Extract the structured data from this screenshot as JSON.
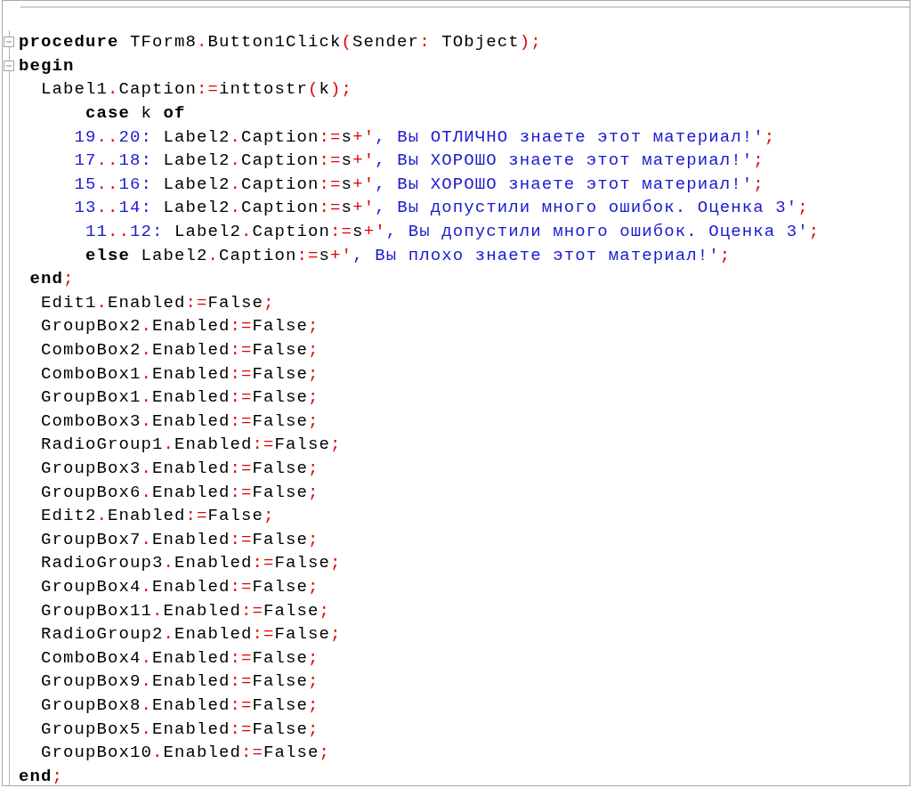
{
  "editor": {
    "lines": [
      {
        "expanded": true,
        "tokens": [
          {
            "text": "procedure",
            "kind": "keyword"
          },
          {
            "text": " TForm8",
            "kind": "ident"
          },
          {
            "text": ".",
            "kind": "symbol"
          },
          {
            "text": "Button1Click",
            "kind": "ident"
          },
          {
            "text": "(",
            "kind": "symbol"
          },
          {
            "text": "Sender",
            "kind": "ident"
          },
          {
            "text": ":",
            "kind": "symbol"
          },
          {
            "text": " TObject",
            "kind": "ident"
          },
          {
            "text": ");",
            "kind": "symbol"
          }
        ]
      },
      {
        "expanded": true,
        "tokens": [
          {
            "text": "begin",
            "kind": "keyword"
          }
        ]
      },
      {
        "tokens": [
          {
            "text": "  Label1",
            "kind": "ident"
          },
          {
            "text": ".",
            "kind": "symbol"
          },
          {
            "text": "Caption",
            "kind": "ident"
          },
          {
            "text": ":=",
            "kind": "symbol"
          },
          {
            "text": "inttostr",
            "kind": "ident"
          },
          {
            "text": "(",
            "kind": "symbol"
          },
          {
            "text": "k",
            "kind": "ident"
          },
          {
            "text": ");",
            "kind": "symbol"
          }
        ]
      },
      {
        "tokens": [
          {
            "text": "      case",
            "kind": "keyword"
          },
          {
            "text": " k ",
            "kind": "ident"
          },
          {
            "text": "of",
            "kind": "keyword"
          }
        ]
      },
      {
        "tokens": [
          {
            "text": "     19",
            "kind": "number"
          },
          {
            "text": "..",
            "kind": "symbol"
          },
          {
            "text": "20:",
            "kind": "number"
          },
          {
            "text": " Label2",
            "kind": "ident"
          },
          {
            "text": ".",
            "kind": "symbol"
          },
          {
            "text": "Caption",
            "kind": "ident"
          },
          {
            "text": ":=",
            "kind": "symbol"
          },
          {
            "text": "s",
            "kind": "ident"
          },
          {
            "text": "+'",
            "kind": "symbol"
          },
          {
            "text": ", Вы ОТЛИЧНО знаете этот материал!'",
            "kind": "string"
          },
          {
            "text": ";",
            "kind": "symbol"
          }
        ]
      },
      {
        "tokens": [
          {
            "text": "     17",
            "kind": "number"
          },
          {
            "text": "..",
            "kind": "symbol"
          },
          {
            "text": "18:",
            "kind": "number"
          },
          {
            "text": " Label2",
            "kind": "ident"
          },
          {
            "text": ".",
            "kind": "symbol"
          },
          {
            "text": "Caption",
            "kind": "ident"
          },
          {
            "text": ":=",
            "kind": "symbol"
          },
          {
            "text": "s",
            "kind": "ident"
          },
          {
            "text": "+'",
            "kind": "symbol"
          },
          {
            "text": ", Вы ХОРОШО знаете этот материал!'",
            "kind": "string"
          },
          {
            "text": ";",
            "kind": "symbol"
          }
        ]
      },
      {
        "tokens": [
          {
            "text": "     15",
            "kind": "number"
          },
          {
            "text": "..",
            "kind": "symbol"
          },
          {
            "text": "16:",
            "kind": "number"
          },
          {
            "text": " Label2",
            "kind": "ident"
          },
          {
            "text": ".",
            "kind": "symbol"
          },
          {
            "text": "Caption",
            "kind": "ident"
          },
          {
            "text": ":=",
            "kind": "symbol"
          },
          {
            "text": "s",
            "kind": "ident"
          },
          {
            "text": "+'",
            "kind": "symbol"
          },
          {
            "text": ", Вы ХОРОШО знаете этот материал!'",
            "kind": "string"
          },
          {
            "text": ";",
            "kind": "symbol"
          }
        ]
      },
      {
        "tokens": [
          {
            "text": "     13",
            "kind": "number"
          },
          {
            "text": "..",
            "kind": "symbol"
          },
          {
            "text": "14:",
            "kind": "number"
          },
          {
            "text": " Label2",
            "kind": "ident"
          },
          {
            "text": ".",
            "kind": "symbol"
          },
          {
            "text": "Caption",
            "kind": "ident"
          },
          {
            "text": ":=",
            "kind": "symbol"
          },
          {
            "text": "s",
            "kind": "ident"
          },
          {
            "text": "+'",
            "kind": "symbol"
          },
          {
            "text": ", Вы допустили много ошибок. Оценка 3'",
            "kind": "string"
          },
          {
            "text": ";",
            "kind": "symbol"
          }
        ]
      },
      {
        "tokens": [
          {
            "text": "      11",
            "kind": "number"
          },
          {
            "text": "..",
            "kind": "symbol"
          },
          {
            "text": "12:",
            "kind": "number"
          },
          {
            "text": " Label2",
            "kind": "ident"
          },
          {
            "text": ".",
            "kind": "symbol"
          },
          {
            "text": "Caption",
            "kind": "ident"
          },
          {
            "text": ":=",
            "kind": "symbol"
          },
          {
            "text": "s",
            "kind": "ident"
          },
          {
            "text": "+'",
            "kind": "symbol"
          },
          {
            "text": ", Вы допустили много ошибок. Оценка 3'",
            "kind": "string"
          },
          {
            "text": ";",
            "kind": "symbol"
          }
        ]
      },
      {
        "tokens": [
          {
            "text": "      else",
            "kind": "keyword"
          },
          {
            "text": " Label2",
            "kind": "ident"
          },
          {
            "text": ".",
            "kind": "symbol"
          },
          {
            "text": "Caption",
            "kind": "ident"
          },
          {
            "text": ":=",
            "kind": "symbol"
          },
          {
            "text": "s",
            "kind": "ident"
          },
          {
            "text": "+'",
            "kind": "symbol"
          },
          {
            "text": ", Вы плохо знаете этот материал!'",
            "kind": "string"
          },
          {
            "text": ";",
            "kind": "symbol"
          }
        ]
      },
      {
        "tokens": [
          {
            "text": " end",
            "kind": "keyword"
          },
          {
            "text": ";",
            "kind": "symbol"
          }
        ]
      },
      {
        "tokens": [
          {
            "text": "  Edit1",
            "kind": "ident"
          },
          {
            "text": ".",
            "kind": "symbol"
          },
          {
            "text": "Enabled",
            "kind": "ident"
          },
          {
            "text": ":=",
            "kind": "symbol"
          },
          {
            "text": "False",
            "kind": "ident"
          },
          {
            "text": ";",
            "kind": "symbol"
          }
        ]
      },
      {
        "tokens": [
          {
            "text": "  GroupBox2",
            "kind": "ident"
          },
          {
            "text": ".",
            "kind": "symbol"
          },
          {
            "text": "Enabled",
            "kind": "ident"
          },
          {
            "text": ":=",
            "kind": "symbol"
          },
          {
            "text": "False",
            "kind": "ident"
          },
          {
            "text": ";",
            "kind": "symbol"
          }
        ]
      },
      {
        "tokens": [
          {
            "text": "  ComboBox2",
            "kind": "ident"
          },
          {
            "text": ".",
            "kind": "symbol"
          },
          {
            "text": "Enabled",
            "kind": "ident"
          },
          {
            "text": ":=",
            "kind": "symbol"
          },
          {
            "text": "False",
            "kind": "ident"
          },
          {
            "text": ";",
            "kind": "symbol"
          }
        ]
      },
      {
        "tokens": [
          {
            "text": "  ComboBox1",
            "kind": "ident"
          },
          {
            "text": ".",
            "kind": "symbol"
          },
          {
            "text": "Enabled",
            "kind": "ident"
          },
          {
            "text": ":=",
            "kind": "symbol"
          },
          {
            "text": "False",
            "kind": "ident"
          },
          {
            "text": ";",
            "kind": "symbol"
          }
        ]
      },
      {
        "tokens": [
          {
            "text": "  GroupBox1",
            "kind": "ident"
          },
          {
            "text": ".",
            "kind": "symbol"
          },
          {
            "text": "Enabled",
            "kind": "ident"
          },
          {
            "text": ":=",
            "kind": "symbol"
          },
          {
            "text": "False",
            "kind": "ident"
          },
          {
            "text": ";",
            "kind": "symbol"
          }
        ]
      },
      {
        "tokens": [
          {
            "text": "  ComboBox3",
            "kind": "ident"
          },
          {
            "text": ".",
            "kind": "symbol"
          },
          {
            "text": "Enabled",
            "kind": "ident"
          },
          {
            "text": ":=",
            "kind": "symbol"
          },
          {
            "text": "False",
            "kind": "ident"
          },
          {
            "text": ";",
            "kind": "symbol"
          }
        ]
      },
      {
        "tokens": [
          {
            "text": "  RadioGroup1",
            "kind": "ident"
          },
          {
            "text": ".",
            "kind": "symbol"
          },
          {
            "text": "Enabled",
            "kind": "ident"
          },
          {
            "text": ":=",
            "kind": "symbol"
          },
          {
            "text": "False",
            "kind": "ident"
          },
          {
            "text": ";",
            "kind": "symbol"
          }
        ]
      },
      {
        "tokens": [
          {
            "text": "  GroupBox3",
            "kind": "ident"
          },
          {
            "text": ".",
            "kind": "symbol"
          },
          {
            "text": "Enabled",
            "kind": "ident"
          },
          {
            "text": ":=",
            "kind": "symbol"
          },
          {
            "text": "False",
            "kind": "ident"
          },
          {
            "text": ";",
            "kind": "symbol"
          }
        ]
      },
      {
        "tokens": [
          {
            "text": "  GroupBox6",
            "kind": "ident"
          },
          {
            "text": ".",
            "kind": "symbol"
          },
          {
            "text": "Enabled",
            "kind": "ident"
          },
          {
            "text": ":=",
            "kind": "symbol"
          },
          {
            "text": "False",
            "kind": "ident"
          },
          {
            "text": ";",
            "kind": "symbol"
          }
        ]
      },
      {
        "tokens": [
          {
            "text": "  Edit2",
            "kind": "ident"
          },
          {
            "text": ".",
            "kind": "symbol"
          },
          {
            "text": "Enabled",
            "kind": "ident"
          },
          {
            "text": ":=",
            "kind": "symbol"
          },
          {
            "text": "False",
            "kind": "ident"
          },
          {
            "text": ";",
            "kind": "symbol"
          }
        ]
      },
      {
        "tokens": [
          {
            "text": "  GroupBox7",
            "kind": "ident"
          },
          {
            "text": ".",
            "kind": "symbol"
          },
          {
            "text": "Enabled",
            "kind": "ident"
          },
          {
            "text": ":=",
            "kind": "symbol"
          },
          {
            "text": "False",
            "kind": "ident"
          },
          {
            "text": ";",
            "kind": "symbol"
          }
        ]
      },
      {
        "tokens": [
          {
            "text": "  RadioGroup3",
            "kind": "ident"
          },
          {
            "text": ".",
            "kind": "symbol"
          },
          {
            "text": "Enabled",
            "kind": "ident"
          },
          {
            "text": ":=",
            "kind": "symbol"
          },
          {
            "text": "False",
            "kind": "ident"
          },
          {
            "text": ";",
            "kind": "symbol"
          }
        ]
      },
      {
        "tokens": [
          {
            "text": "  GroupBox4",
            "kind": "ident"
          },
          {
            "text": ".",
            "kind": "symbol"
          },
          {
            "text": "Enabled",
            "kind": "ident"
          },
          {
            "text": ":=",
            "kind": "symbol"
          },
          {
            "text": "False",
            "kind": "ident"
          },
          {
            "text": ";",
            "kind": "symbol"
          }
        ]
      },
      {
        "tokens": [
          {
            "text": "  GroupBox11",
            "kind": "ident"
          },
          {
            "text": ".",
            "kind": "symbol"
          },
          {
            "text": "Enabled",
            "kind": "ident"
          },
          {
            "text": ":=",
            "kind": "symbol"
          },
          {
            "text": "False",
            "kind": "ident"
          },
          {
            "text": ";",
            "kind": "symbol"
          }
        ]
      },
      {
        "tokens": [
          {
            "text": "  RadioGroup2",
            "kind": "ident"
          },
          {
            "text": ".",
            "kind": "symbol"
          },
          {
            "text": "Enabled",
            "kind": "ident"
          },
          {
            "text": ":=",
            "kind": "symbol"
          },
          {
            "text": "False",
            "kind": "ident"
          },
          {
            "text": ";",
            "kind": "symbol"
          }
        ]
      },
      {
        "tokens": [
          {
            "text": "  ComboBox4",
            "kind": "ident"
          },
          {
            "text": ".",
            "kind": "symbol"
          },
          {
            "text": "Enabled",
            "kind": "ident"
          },
          {
            "text": ":=",
            "kind": "symbol"
          },
          {
            "text": "False",
            "kind": "ident"
          },
          {
            "text": ";",
            "kind": "symbol"
          }
        ]
      },
      {
        "tokens": [
          {
            "text": "  GroupBox9",
            "kind": "ident"
          },
          {
            "text": ".",
            "kind": "symbol"
          },
          {
            "text": "Enabled",
            "kind": "ident"
          },
          {
            "text": ":=",
            "kind": "symbol"
          },
          {
            "text": "False",
            "kind": "ident"
          },
          {
            "text": ";",
            "kind": "symbol"
          }
        ]
      },
      {
        "tokens": [
          {
            "text": "  GroupBox8",
            "kind": "ident"
          },
          {
            "text": ".",
            "kind": "symbol"
          },
          {
            "text": "Enabled",
            "kind": "ident"
          },
          {
            "text": ":=",
            "kind": "symbol"
          },
          {
            "text": "False",
            "kind": "ident"
          },
          {
            "text": ";",
            "kind": "symbol"
          }
        ]
      },
      {
        "tokens": [
          {
            "text": "  GroupBox5",
            "kind": "ident"
          },
          {
            "text": ".",
            "kind": "symbol"
          },
          {
            "text": "Enabled",
            "kind": "ident"
          },
          {
            "text": ":=",
            "kind": "symbol"
          },
          {
            "text": "False",
            "kind": "ident"
          },
          {
            "text": ";",
            "kind": "symbol"
          }
        ]
      },
      {
        "tokens": [
          {
            "text": "  GroupBox10",
            "kind": "ident"
          },
          {
            "text": ".",
            "kind": "symbol"
          },
          {
            "text": "Enabled",
            "kind": "ident"
          },
          {
            "text": ":=",
            "kind": "symbol"
          },
          {
            "text": "False",
            "kind": "ident"
          },
          {
            "text": ";",
            "kind": "symbol"
          }
        ]
      },
      {
        "tokens": [
          {
            "text": "end",
            "kind": "keyword"
          },
          {
            "text": ";",
            "kind": "symbol"
          }
        ]
      }
    ]
  }
}
